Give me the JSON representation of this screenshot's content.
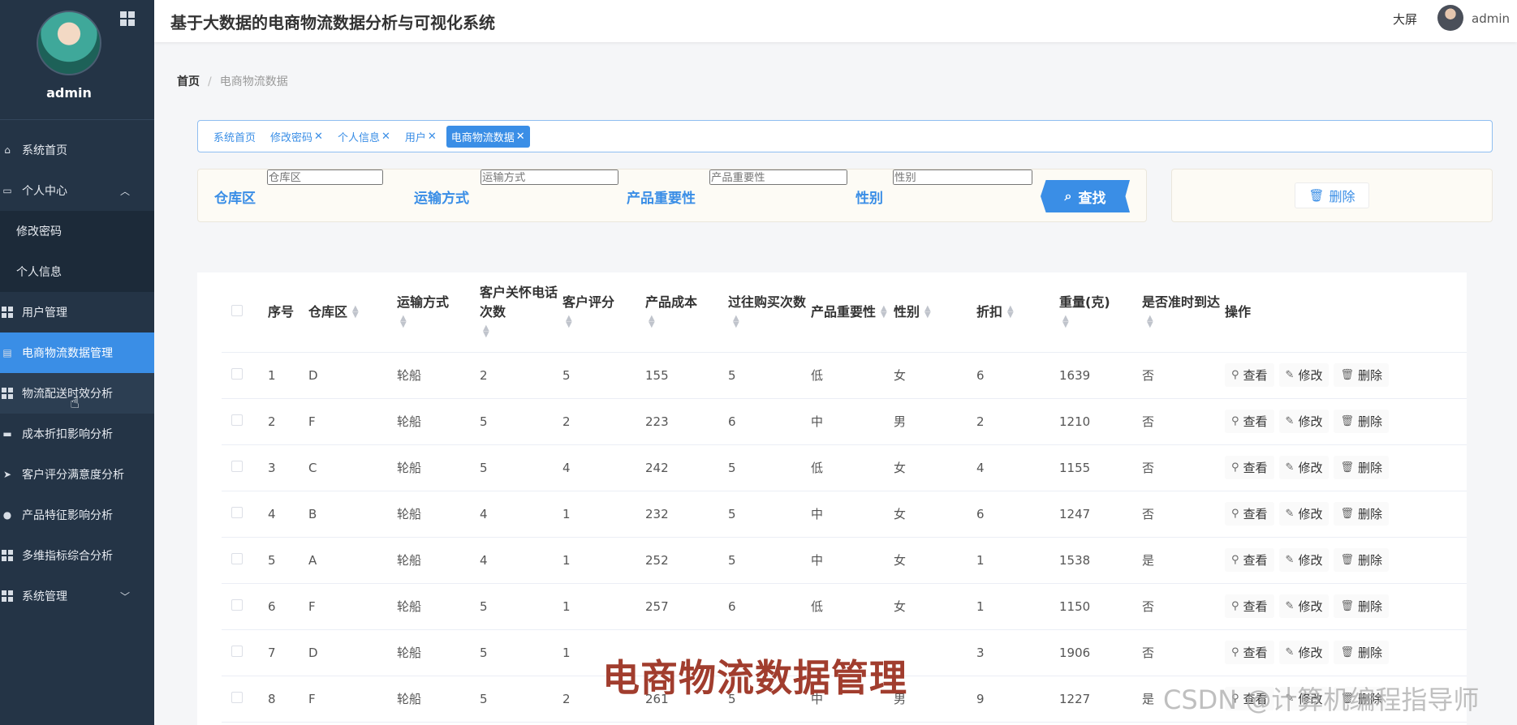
{
  "app": {
    "title": "基于大数据的电商物流数据分析与可视化系统",
    "bigscreen": "大屏",
    "username": "admin"
  },
  "sidebar": {
    "username": "admin",
    "items": [
      {
        "label": "系统首页",
        "icon": "home-icon"
      },
      {
        "label": "个人中心",
        "icon": "window-icon"
      },
      {
        "label": "修改密码"
      },
      {
        "label": "个人信息"
      },
      {
        "label": "用户管理",
        "icon": "grid-icon"
      },
      {
        "label": "电商物流数据管理",
        "icon": "db-icon"
      },
      {
        "label": "物流配送时效分析",
        "icon": "grid-icon"
      },
      {
        "label": "成本折扣影响分析",
        "icon": "print-icon"
      },
      {
        "label": "客户评分满意度分析",
        "icon": "plane-icon"
      },
      {
        "label": "产品特征影响分析",
        "icon": "location-icon"
      },
      {
        "label": "多维指标综合分析",
        "icon": "grid-icon"
      },
      {
        "label": "系统管理",
        "icon": "grid-icon"
      }
    ]
  },
  "breadcrumb": {
    "home": "首页",
    "current": "电商物流数据"
  },
  "tabs": [
    "系统首页",
    "修改密码",
    "个人信息",
    "用户",
    "电商物流数据"
  ],
  "search": {
    "fields": [
      {
        "label": "仓库区",
        "placeholder": "仓库区"
      },
      {
        "label": "运输方式",
        "placeholder": "运输方式"
      },
      {
        "label": "产品重要性",
        "placeholder": "产品重要性"
      },
      {
        "label": "性别",
        "placeholder": "性别"
      }
    ],
    "button": "查找"
  },
  "actions": {
    "delete": "删除"
  },
  "table": {
    "headers": [
      "序号",
      "仓库区",
      "运输方式",
      "客户关怀电话次数",
      "客户评分",
      "产品成本",
      "过往购买次数",
      "产品重要性",
      "性别",
      "折扣",
      "重量(克)",
      "是否准时到达",
      "操作"
    ],
    "ops": [
      "查看",
      "修改",
      "删除"
    ],
    "rows": [
      [
        "1",
        "D",
        "轮船",
        "2",
        "5",
        "155",
        "5",
        "低",
        "女",
        "6",
        "1639",
        "否"
      ],
      [
        "2",
        "F",
        "轮船",
        "5",
        "2",
        "223",
        "6",
        "中",
        "男",
        "2",
        "1210",
        "否"
      ],
      [
        "3",
        "C",
        "轮船",
        "5",
        "4",
        "242",
        "5",
        "低",
        "女",
        "4",
        "1155",
        "否"
      ],
      [
        "4",
        "B",
        "轮船",
        "4",
        "1",
        "232",
        "5",
        "中",
        "女",
        "6",
        "1247",
        "否"
      ],
      [
        "5",
        "A",
        "轮船",
        "4",
        "1",
        "252",
        "5",
        "中",
        "女",
        "1",
        "1538",
        "是"
      ],
      [
        "6",
        "F",
        "轮船",
        "5",
        "1",
        "257",
        "6",
        "低",
        "女",
        "1",
        "1150",
        "否"
      ],
      [
        "7",
        "D",
        "轮船",
        "5",
        "1",
        "",
        "",
        "",
        "",
        "3",
        "1906",
        "否"
      ],
      [
        "8",
        "F",
        "轮船",
        "5",
        "2",
        "261",
        "5",
        "中",
        "男",
        "9",
        "1227",
        "是"
      ]
    ]
  },
  "overlay": {
    "title": "电商物流数据管理",
    "watermark": "CSDN @计算机编程指导师"
  }
}
